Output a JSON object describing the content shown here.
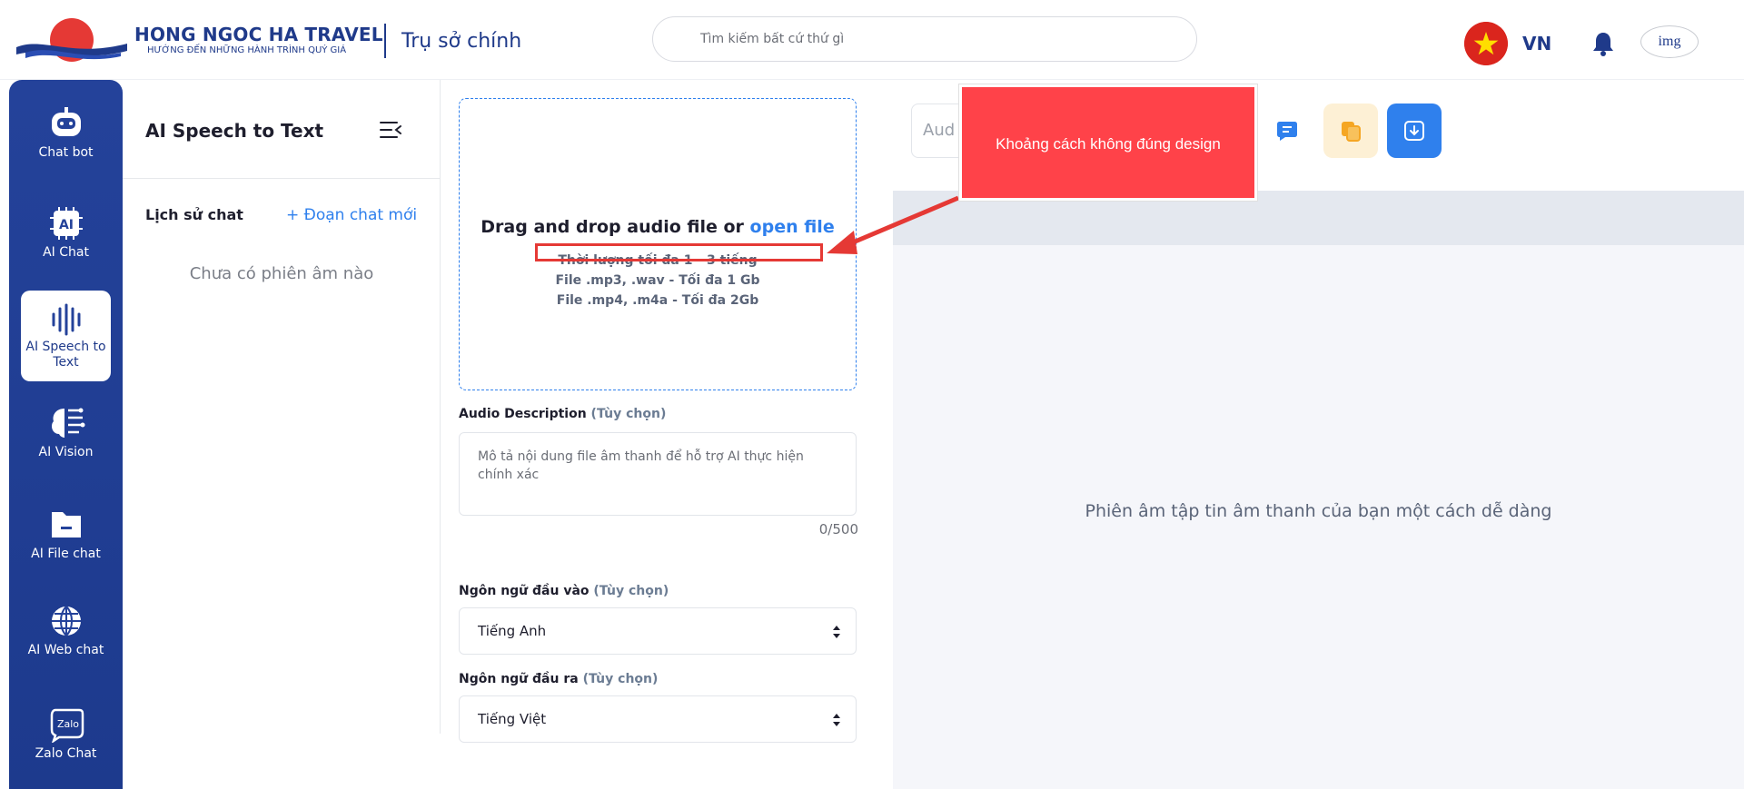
{
  "header": {
    "brand_name": "HONG NGOC HA TRAVEL",
    "brand_tagline": "HƯỚNG ĐẾN NHỮNG HÀNH TRÌNH QUÝ GIÁ",
    "office": "Trụ sở chính",
    "search_placeholder": "Tìm kiếm bất cứ thứ gì",
    "language": "VN",
    "avatar_alt": "img"
  },
  "rail": {
    "items": [
      {
        "label": "Chat bot",
        "icon": "robot-icon"
      },
      {
        "label": "AI Chat",
        "icon": "ai-chip-icon"
      },
      {
        "label": "AI Speech to Text",
        "icon": "soundwave-icon",
        "active": true
      },
      {
        "label": "AI Vision",
        "icon": "brain-icon"
      },
      {
        "label": "AI File chat",
        "icon": "folder-icon"
      },
      {
        "label": "AI Web chat",
        "icon": "globe-icon"
      },
      {
        "label": "Zalo Chat",
        "icon": "zalo-icon"
      }
    ]
  },
  "panel": {
    "title": "AI Speech to Text",
    "history_label": "Lịch sử chat",
    "new_chat": "+ Đoạn chat mới",
    "empty": "Chưa có phiên âm nào"
  },
  "upload": {
    "title_prefix": "Drag and drop audio file or",
    "open_file": "open file",
    "line1": "Thời lượng tối đa 1 - 3 tiếng",
    "line2": "File .mp3, .wav - Tối đa 1 Gb",
    "line3": "File .mp4, .m4a - Tối đa 2Gb"
  },
  "description": {
    "label": "Audio Description",
    "optional": "(Tùy chọn)",
    "placeholder": "Mô tả nội dung file âm thanh để hỗ trợ AI thực hiện chính xác",
    "counter": "0/500"
  },
  "input_lang": {
    "label": "Ngôn ngữ đầu vào",
    "optional": "(Tùy chọn)",
    "value": "Tiếng Anh"
  },
  "output_lang": {
    "label": "Ngôn ngữ đầu ra",
    "optional": "(Tùy chọn)",
    "value": "Tiếng Việt"
  },
  "result": {
    "audio_placeholder": "Aud",
    "empty": "Phiên âm tập tin âm thanh của bạn một cách dễ dàng",
    "buttons": [
      {
        "icon": "chat-bubble-icon",
        "color": "#2f80ed",
        "bg": "#ffffff"
      },
      {
        "icon": "copy-icon",
        "color": "#f5a623",
        "bg": "#fdf0d5"
      },
      {
        "icon": "download-icon",
        "color": "#ffffff",
        "bg": "#2f80ed"
      }
    ]
  },
  "annotation": {
    "text": "Khoảng cách không đúng design",
    "color": "#ff4249"
  }
}
